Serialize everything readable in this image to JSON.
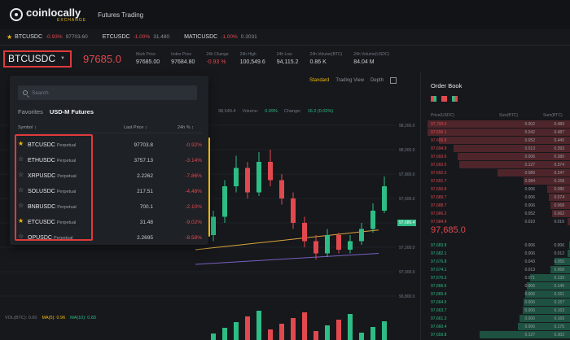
{
  "header": {
    "logo_name": "coinlocally",
    "logo_sub": "EXCHANGE",
    "nav": "Futures Trading"
  },
  "ticker": [
    {
      "sym": "BTCUSDC",
      "chg": "-0.93%",
      "price": "97703.60"
    },
    {
      "sym": "ETCUSDC",
      "chg": "-1.00%",
      "price": "31.480"
    },
    {
      "sym": "MATICUSDC",
      "chg": "-1.00%",
      "price": "0.3031"
    }
  ],
  "symbar": {
    "symbol": "BTCUSDC",
    "price": "97685.0",
    "stats": [
      {
        "label": "Mark Price",
        "value": "97685.00",
        "red": false
      },
      {
        "label": "Index Price",
        "value": "97684.80",
        "red": false
      },
      {
        "label": "24h Change",
        "value": "-0.93 %",
        "red": true
      },
      {
        "label": "24h High",
        "value": "100,549.6",
        "red": false
      },
      {
        "label": "24h Low",
        "value": "94,115.2",
        "red": false
      },
      {
        "label": "24h Volume(BTC)",
        "value": "0.86 K",
        "red": false
      },
      {
        "label": "24h Volume(USDC)",
        "value": "84.04 M",
        "red": false
      }
    ]
  },
  "chart": {
    "tabs": [
      "Standard",
      "Trading View",
      "Depth"
    ],
    "info": {
      "val": "98,549.4",
      "volume_label": "Volume:",
      "volume": "0.09%",
      "change_label": "Change:",
      "change": "16.2 (0.02%)"
    },
    "price_labels": [
      "98,200.0",
      "98,000.0",
      "97,800.0",
      "97,600.0",
      "97,400.0",
      "97,200.0",
      "97,000.0",
      "96,800.0"
    ],
    "price_tag": "97,686.4",
    "vol_labels": [
      "VOL(BTC): 0.00",
      "MA(5): 0.96",
      "MA(10): 0.83"
    ]
  },
  "panel": {
    "search_placeholder": "Search",
    "tabs": [
      "Favorites",
      "USD-M Futures"
    ],
    "headers": {
      "symbol": "Symbol ↕",
      "last": "Last Price ↕",
      "pct": "24h % ↕"
    },
    "rows": [
      {
        "sym": "BTCUSDC",
        "type": "Perpetual",
        "last": "97703.8",
        "pct": "-0.92%",
        "fav": true
      },
      {
        "sym": "ETHUSDC",
        "type": "Perpetual",
        "last": "3757.13",
        "pct": "-3.14%",
        "fav": false
      },
      {
        "sym": "XRPUSDC",
        "type": "Perpetual",
        "last": "2.2262",
        "pct": "-7.86%",
        "fav": false
      },
      {
        "sym": "SOLUSDC",
        "type": "Perpetual",
        "last": "217.51",
        "pct": "-4.48%",
        "fav": false
      },
      {
        "sym": "BNBUSDC",
        "type": "Perpetual",
        "last": "700.1",
        "pct": "-2.10%",
        "fav": false
      },
      {
        "sym": "ETCUSDC",
        "type": "Perpetual",
        "last": "31.48",
        "pct": "-9.02%",
        "fav": true
      },
      {
        "sym": "OPUSDC",
        "type": "Perpetual",
        "last": "2.2695",
        "pct": "-8.58%",
        "fav": false
      }
    ]
  },
  "orderbook": {
    "title": "Order Book",
    "headers": [
      "Price(USDC)",
      "Size(BTC)",
      "Sum(BTC)"
    ],
    "mid_price": "97,685.0",
    "asks": [
      {
        "p": "97,700.0",
        "s": "0.002",
        "t": "0.489",
        "d": 0.98
      },
      {
        "p": "97,696.1",
        "s": "0.042",
        "t": "0.487",
        "d": 0.98
      },
      {
        "p": "97,695.8",
        "s": "0.052",
        "t": "0.445",
        "d": 0.9
      },
      {
        "p": "97,694.9",
        "s": "0.013",
        "t": "0.393",
        "d": 0.8
      },
      {
        "p": "97,693.6",
        "s": "0.006",
        "t": "0.380",
        "d": 0.77
      },
      {
        "p": "97,693.5",
        "s": "0.127",
        "t": "0.374",
        "d": 0.76
      },
      {
        "p": "97,692.2",
        "s": "0.089",
        "t": "0.247",
        "d": 0.5
      },
      {
        "p": "97,691.7",
        "s": "0.084",
        "t": "0.158",
        "d": 0.32
      },
      {
        "p": "97,690.8",
        "s": "0.006",
        "t": "0.080",
        "d": 0.16
      },
      {
        "p": "97,689.7",
        "s": "0.006",
        "t": "0.074",
        "d": 0.15
      },
      {
        "p": "97,688.7",
        "s": "0.006",
        "t": "0.068",
        "d": 0.14
      },
      {
        "p": "97,686.2",
        "s": "0.052",
        "t": "0.062",
        "d": 0.13
      },
      {
        "p": "97,684.9",
        "s": "0.010",
        "t": "0.010",
        "d": 0.02
      }
    ],
    "bids": [
      {
        "p": "97,683.8",
        "s": "0.006",
        "t": "0.006",
        "d": 0.01
      },
      {
        "p": "97,682.1",
        "s": "0.006",
        "t": "0.012",
        "d": 0.02
      },
      {
        "p": "97,676.8",
        "s": "0.043",
        "t": "0.055",
        "d": 0.11
      },
      {
        "p": "97,674.1",
        "s": "0.013",
        "t": "0.068",
        "d": 0.14
      },
      {
        "p": "97,670.3",
        "s": "0.071",
        "t": "0.139",
        "d": 0.28
      },
      {
        "p": "97,666.6",
        "s": "0.006",
        "t": "0.145",
        "d": 0.3
      },
      {
        "p": "97,665.4",
        "s": "0.006",
        "t": "0.151",
        "d": 0.31
      },
      {
        "p": "97,664.5",
        "s": "0.006",
        "t": "0.157",
        "d": 0.32
      },
      {
        "p": "97,663.7",
        "s": "0.006",
        "t": "0.163",
        "d": 0.33
      },
      {
        "p": "97,661.3",
        "s": "0.006",
        "t": "0.169",
        "d": 0.35
      },
      {
        "p": "97,660.4",
        "s": "0.006",
        "t": "0.175",
        "d": 0.36
      },
      {
        "p": "97,659.8",
        "s": "0.127",
        "t": "0.302",
        "d": 0.62
      }
    ]
  },
  "candles": [
    {
      "o": 97300,
      "c": 97450,
      "h": 97500,
      "l": 97250
    },
    {
      "o": 97450,
      "c": 97700,
      "h": 97750,
      "l": 97400
    },
    {
      "o": 97700,
      "c": 97850,
      "h": 97950,
      "l": 97650
    },
    {
      "o": 97850,
      "c": 97650,
      "h": 97900,
      "l": 97600
    },
    {
      "o": 97650,
      "c": 97900,
      "h": 97980,
      "l": 97620
    },
    {
      "o": 97900,
      "c": 97750,
      "h": 98000,
      "l": 97700
    },
    {
      "o": 97750,
      "c": 97600,
      "h": 97800,
      "l": 97550
    },
    {
      "o": 97600,
      "c": 97400,
      "h": 97650,
      "l": 97350
    },
    {
      "o": 97400,
      "c": 97250,
      "h": 97450,
      "l": 97200
    },
    {
      "o": 97250,
      "c": 97150,
      "h": 97300,
      "l": 97100
    },
    {
      "o": 97150,
      "c": 97300,
      "h": 97350,
      "l": 97120
    },
    {
      "o": 97300,
      "c": 97180,
      "h": 97320,
      "l": 97150
    },
    {
      "o": 97180,
      "c": 97250,
      "h": 97300,
      "l": 97150
    },
    {
      "o": 97250,
      "c": 97350,
      "h": 97400,
      "l": 97220
    },
    {
      "o": 97350,
      "c": 97500,
      "h": 97560,
      "l": 97320
    },
    {
      "o": 97500,
      "c": 97700,
      "h": 97780,
      "l": 97480
    }
  ]
}
